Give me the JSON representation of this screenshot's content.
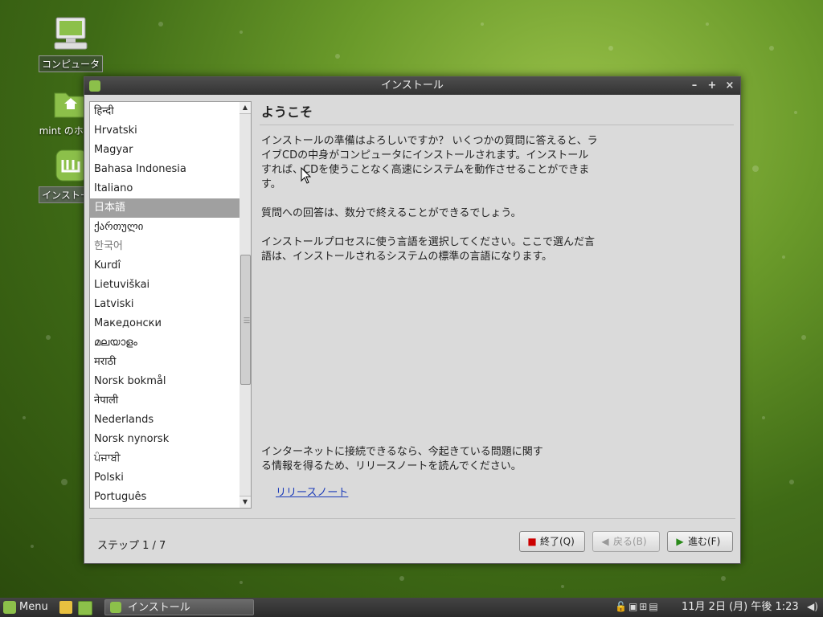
{
  "desktop": {
    "icons": [
      {
        "label": "コンピュータ",
        "icon": "computer-icon"
      },
      {
        "label": "mint のホーム",
        "icon": "home-folder-icon"
      },
      {
        "label": "インストール",
        "icon": "install-icon"
      }
    ]
  },
  "window": {
    "title": "インストール",
    "controls": {
      "minimize": "–",
      "maximize": "+",
      "close": "×"
    }
  },
  "languages": {
    "items": [
      "हिन्दी",
      "Hrvatski",
      "Magyar",
      "Bahasa Indonesia",
      "Italiano",
      "日本語",
      "ქართული",
      "한국어",
      "Kurdî",
      "Lietuviškai",
      "Latviski",
      "Македонски",
      "മലയാളം",
      "मराठी",
      "Norsk bokmål",
      "नेपाली",
      "Nederlands",
      "Norsk nynorsk",
      "ਪੰਜਾਬੀ",
      "Polski",
      "Português"
    ],
    "selected": "日本語"
  },
  "content": {
    "heading": "ようこそ",
    "intro": "インストールの準備はよろしいですか？ いくつかの質問に答えると、ライブCDの中身がコンピュータにインストールされます。インストールすれば、CDを使うことなく高速にシステムを動作させることができます。",
    "answer_time": "質問への回答は、数分で終えることができるでしょう。",
    "choose_language": "インストールプロセスに使う言語を選択してください。ここで選んだ言語は、インストールされるシステムの標準の言語になります。",
    "internet_note": "インターネットに接続できるなら、今起きている問題に関する情報を得るため、リリースノートを読んでください。",
    "release_notes_link": "リリースノート"
  },
  "footer": {
    "step": "ステップ 1 / 7",
    "quit_label": "終了(Q)",
    "back_label": "戻る(B)",
    "forward_label": "進む(F)"
  },
  "panel": {
    "menu_label": "Menu",
    "task_label": "インストール",
    "clock": "11月 2日 (月) 午後 1:23"
  },
  "colors": {
    "accent": "#8cc04a",
    "link": "#1a3ab8",
    "selection": "#a0a0a0"
  }
}
